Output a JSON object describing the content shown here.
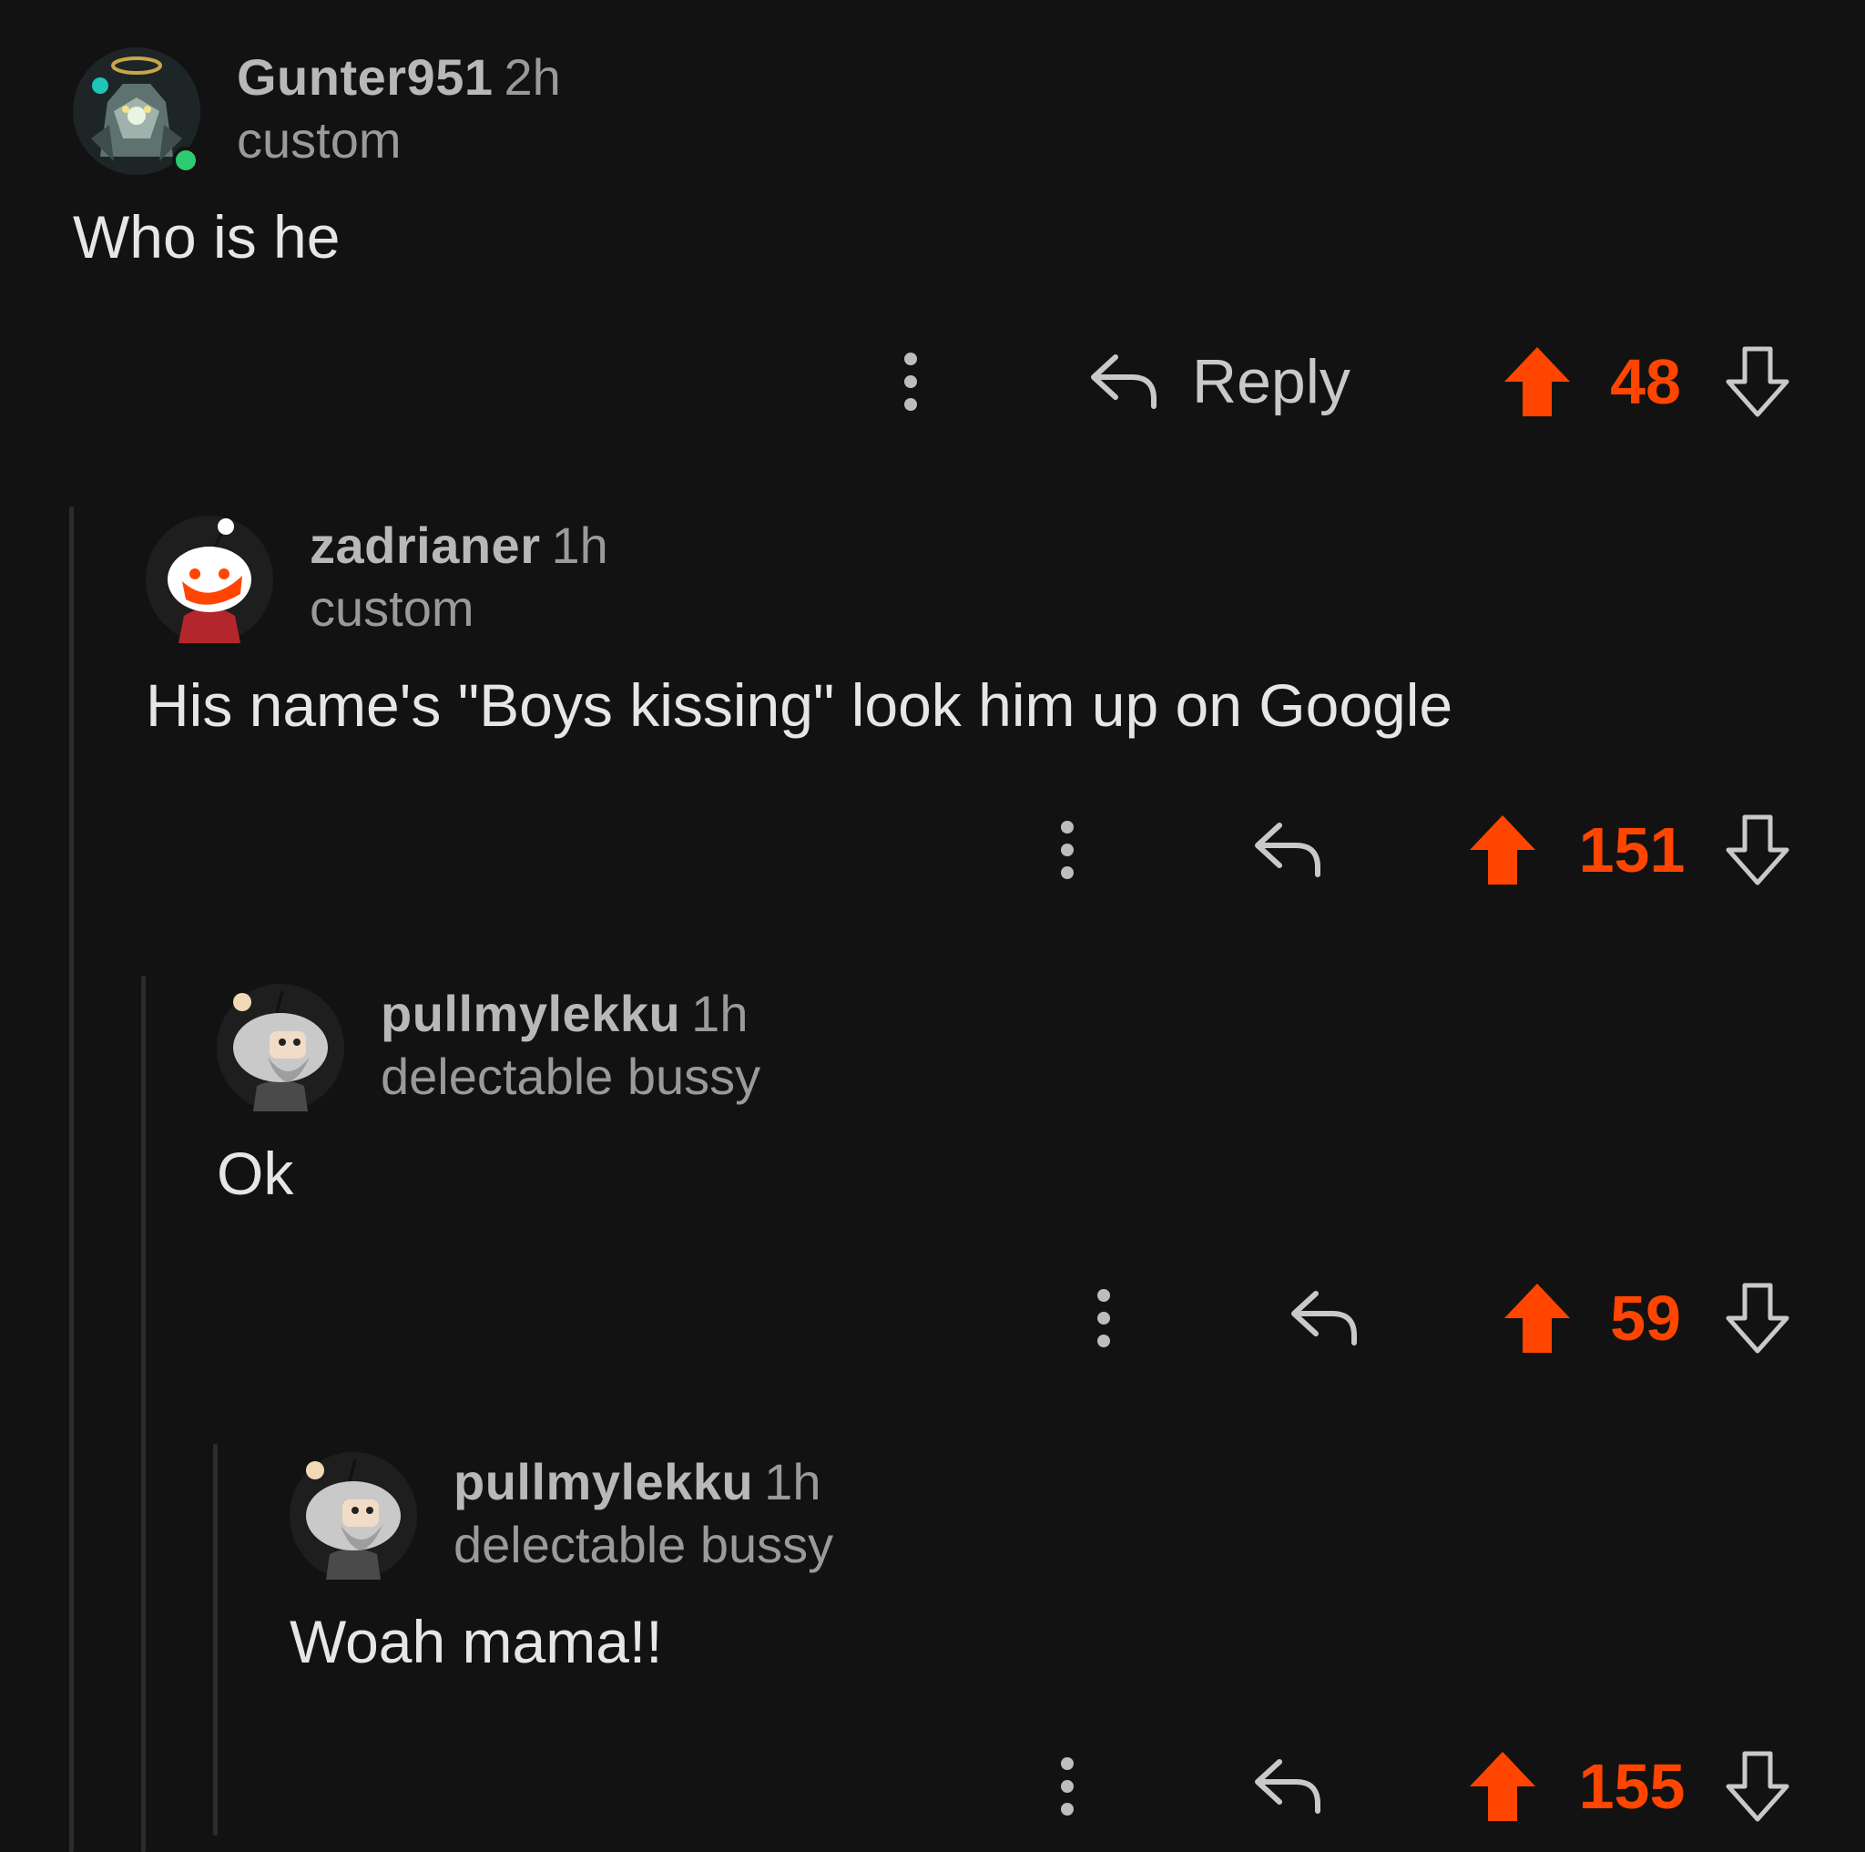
{
  "colors": {
    "background": "#121212",
    "upvote_active": "#ff4500",
    "online_dot": "#2ecc71",
    "thread_line": "#2c2c2c"
  },
  "comments": [
    {
      "username": "Gunter951",
      "time": "2h",
      "flair": "custom",
      "body": "Who is he",
      "reply_label": "Reply",
      "score": "48",
      "upvoted": true,
      "online": true
    },
    {
      "username": "zadrianer",
      "time": "1h",
      "flair": "custom",
      "body": "His name's \"Boys kissing\" look him up on Google",
      "score": "151",
      "upvoted": true
    },
    {
      "username": "pullmylekku",
      "time": "1h",
      "flair": "delectable bussy",
      "body": "Ok",
      "score": "59",
      "upvoted": true
    },
    {
      "username": "pullmylekku",
      "time": "1h",
      "flair": "delectable bussy",
      "body": "Woah mama!!",
      "score": "155",
      "upvoted": true
    }
  ],
  "icons": {
    "more": "more-vertical-icon",
    "reply": "reply-arrow-icon",
    "upvote": "upvote-arrow-icon",
    "downvote": "downvote-arrow-icon"
  }
}
